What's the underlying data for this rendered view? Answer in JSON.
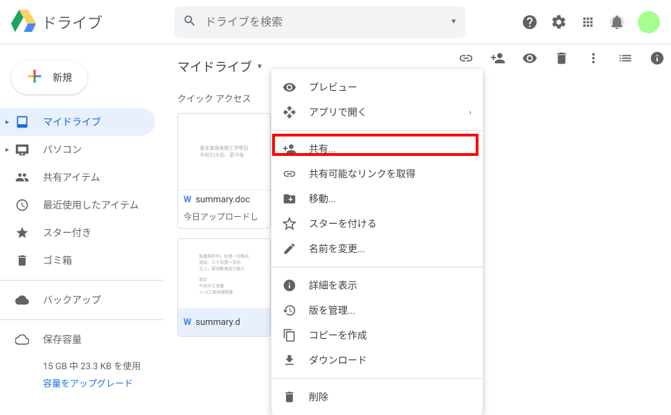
{
  "header": {
    "app_name": "ドライブ",
    "search_placeholder": "ドライブを検索"
  },
  "sidebar": {
    "new_label": "新規",
    "items": [
      {
        "label": "マイドライブ",
        "icon": "drive"
      },
      {
        "label": "パソコン",
        "icon": "computer"
      },
      {
        "label": "共有アイテム",
        "icon": "people"
      },
      {
        "label": "最近使用したアイテム",
        "icon": "clock"
      },
      {
        "label": "スター付き",
        "icon": "star"
      },
      {
        "label": "ゴミ箱",
        "icon": "trash"
      }
    ],
    "backup_label": "バックアップ",
    "storage_label": "保存容量",
    "storage_text": "15 GB 中 23.3 KB を使用",
    "upgrade_text": "容量をアップグレード"
  },
  "main": {
    "breadcrumb": "マイドライブ",
    "quick_access": "クイック アクセス",
    "card1": {
      "filename": "summary.doc",
      "sub": "今日アップロードし"
    },
    "card2": {
      "filename": "summary.d"
    }
  },
  "context_menu": {
    "preview": "プレビュー",
    "open_with": "アプリで開く",
    "share": "共有...",
    "get_link": "共有可能なリンクを取得",
    "move": "移動...",
    "star": "スターを付ける",
    "rename": "名前を変更...",
    "details": "詳細を表示",
    "versions": "版を管理...",
    "copy": "コピーを作成",
    "download": "ダウンロード",
    "delete": "削除"
  }
}
